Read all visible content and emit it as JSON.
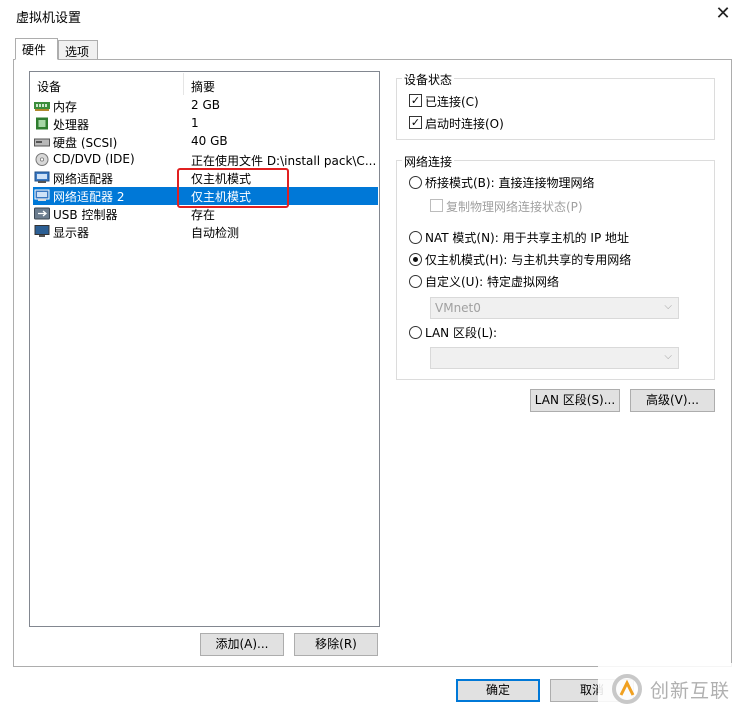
{
  "window": {
    "title": "虚拟机设置",
    "close_glyph": "✕"
  },
  "tabs": [
    {
      "label": "硬件"
    },
    {
      "label": "选项"
    }
  ],
  "device_list": {
    "headers": {
      "device": "设备",
      "summary": "摘要"
    },
    "rows": [
      {
        "name": "内存",
        "summary": "2 GB",
        "icon": "memory-icon"
      },
      {
        "name": "处理器",
        "summary": "1",
        "icon": "processor-icon"
      },
      {
        "name": "硬盘 (SCSI)",
        "summary": "40 GB",
        "icon": "harddisk-icon"
      },
      {
        "name": "CD/DVD (IDE)",
        "summary": "正在使用文件 D:\\install pack\\C...",
        "icon": "cd-dvd-icon"
      },
      {
        "name": "网络适配器",
        "summary": "仅主机模式",
        "icon": "network-adapter-icon"
      },
      {
        "name": "网络适配器 2",
        "summary": "仅主机模式",
        "icon": "network-adapter-icon"
      },
      {
        "name": "USB 控制器",
        "summary": "存在",
        "icon": "usb-icon"
      },
      {
        "name": "显示器",
        "summary": "自动检测",
        "icon": "monitor-icon"
      }
    ],
    "selected_index": 5,
    "add_button": "添加(A)...",
    "remove_button": "移除(R)"
  },
  "device_status": {
    "group_label": "设备状态",
    "connected": {
      "label": "已连接(C)",
      "checked": true
    },
    "connect_at_power_on": {
      "label": "启动时连接(O)",
      "checked": true
    }
  },
  "network_connection": {
    "group_label": "网络连接",
    "bridged": {
      "label": "桥接模式(B): 直接连接物理网络",
      "selected": false
    },
    "replicate_state": {
      "label": "复制物理网络连接状态(P)",
      "checked": false,
      "disabled": true
    },
    "nat": {
      "label": "NAT 模式(N): 用于共享主机的 IP 地址",
      "selected": false
    },
    "host_only": {
      "label": "仅主机模式(H): 与主机共享的专用网络",
      "selected": true
    },
    "custom": {
      "label": "自定义(U): 特定虚拟网络",
      "selected": false
    },
    "custom_select_value": "VMnet0",
    "lan_segment": {
      "label": "LAN 区段(L):",
      "selected": false
    },
    "lan_select_value": ""
  },
  "buttons": {
    "lan_segments": "LAN 区段(S)...",
    "advanced": "高级(V)...",
    "ok": "确定",
    "cancel": "取消"
  },
  "watermark": {
    "text": "创新互联"
  },
  "colors": {
    "selection": "#0078d7",
    "highlight_box": "#e02020"
  }
}
